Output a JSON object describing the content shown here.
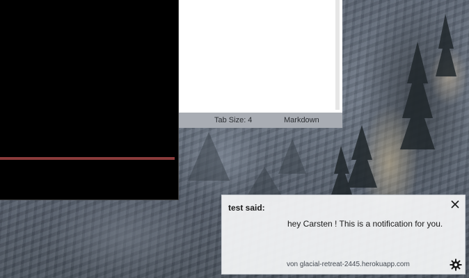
{
  "editor": {
    "statusbar": {
      "tab_size": "Tab Size: 4",
      "language": "Markdown"
    }
  },
  "notification": {
    "title": "test said:",
    "message": "hey Carsten ! This is a notification for you.",
    "source": "von glacial-retreat-2445.herokuapp.com",
    "close_icon": "close-icon",
    "settings_icon": "gear-icon"
  },
  "colors": {
    "terminal_background": "#000000",
    "terminal_progress": "#8a3b3b",
    "statusbar_background": "#a9adb4",
    "notification_background": "#f5f6f8"
  }
}
